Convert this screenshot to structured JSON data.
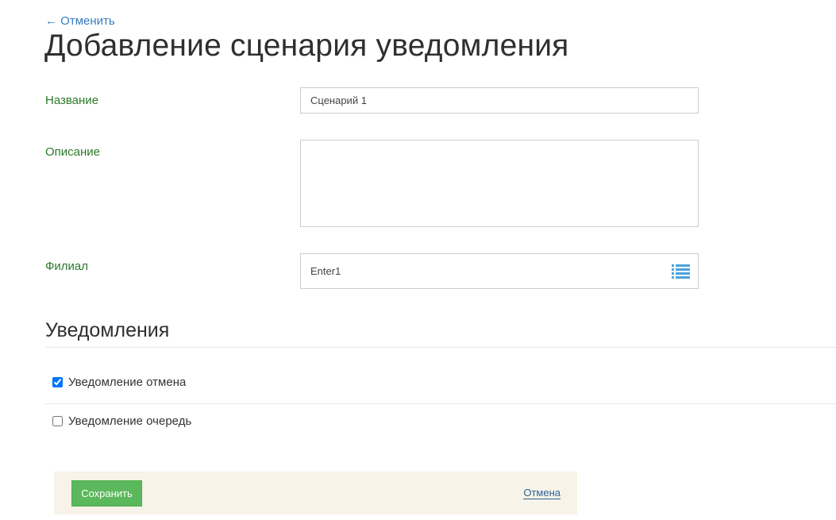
{
  "header": {
    "back_label": "← Отменить",
    "title": "Добавление сценария уведомления"
  },
  "form": {
    "name": {
      "label": "Название",
      "value": "Сценарий 1"
    },
    "description": {
      "label": "Описание",
      "value": ""
    },
    "branch": {
      "label": "Филиал",
      "value": "Enter1",
      "icon": "list-icon",
      "icon_color": "#4aa3dd"
    }
  },
  "notifications": {
    "title": "Уведомления",
    "items": [
      {
        "label": "Уведомление отмена",
        "checked": true
      },
      {
        "label": "Уведомление очередь",
        "checked": false
      }
    ]
  },
  "footer": {
    "save_label": "Сохранить",
    "cancel_label": "Отмена",
    "save_color": "#5cb85c",
    "bar_color": "#f7f3e8"
  },
  "colors": {
    "label": "#2a7a2a",
    "link": "#3a7bbf"
  }
}
